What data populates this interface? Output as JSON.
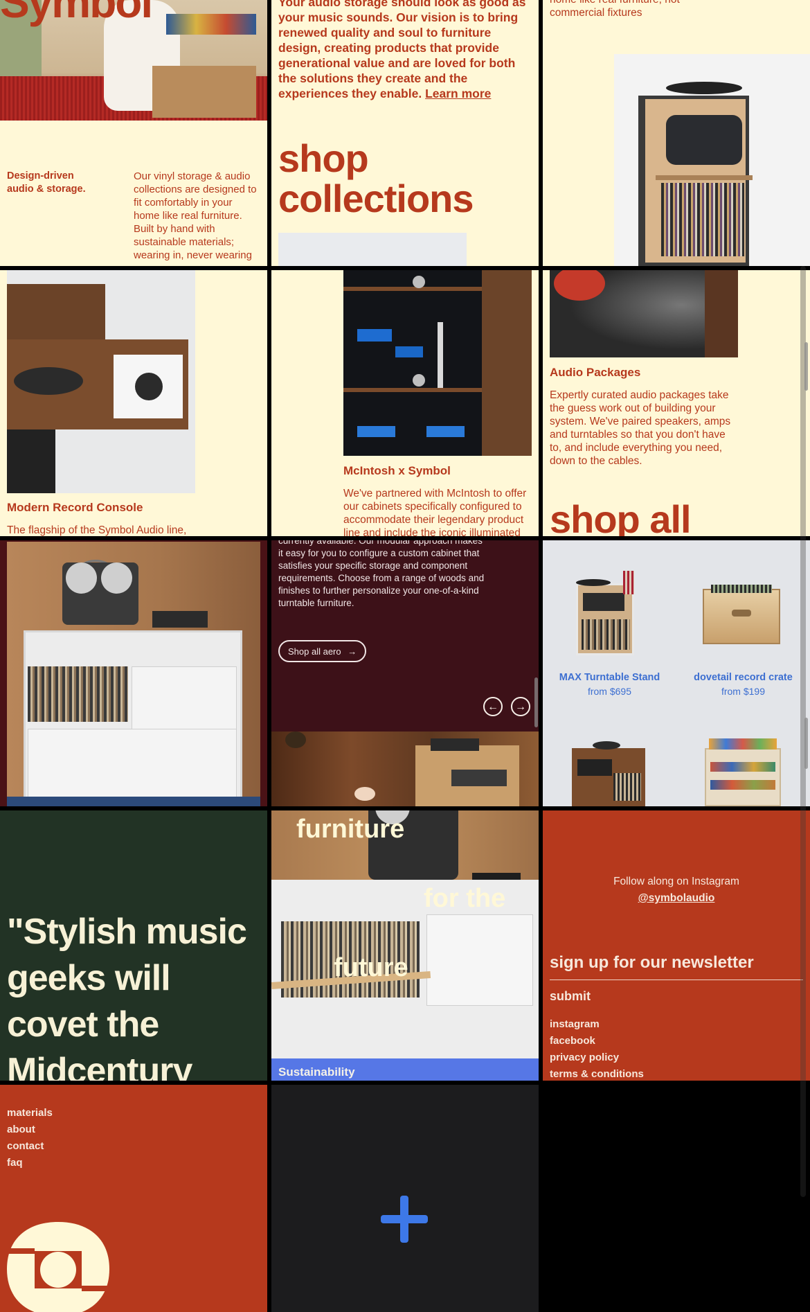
{
  "hero": {
    "brand_word": "Symbol",
    "tagline": "Design-driven audio & storage.",
    "description": "Our vinyl storage & audio collections are designed to fit comfortably in your home like real furniture. Built by hand with sustainable materials; wearing in, never wearing"
  },
  "vision": {
    "text": "Your audio storage should look as good as your music sounds. Our vision is to bring renewed quality and soul to furniture design, creating products that provide generational value and are loved for both the solutions they create and the experiences they enable.",
    "learn_more": "Learn more",
    "shop_collections_line1": "shop",
    "shop_collections_line2": "collections"
  },
  "fixtures": {
    "text_line1": "home like real furniture, not",
    "text_line2": "commercial fixtures"
  },
  "collections": {
    "modern": {
      "title": "Modern Record Console",
      "desc": "The flagship of the Symbol Audio line,"
    },
    "mcintosh": {
      "title": "McIntosh x Symbol",
      "desc": "We've partnered with McIntosh to offer our cabinets specifically configured to accommodate their legendary product line and include the iconic illuminated"
    },
    "audio_packages": {
      "title": "Audio Packages",
      "desc": "Expertly curated audio packages take the guess work out of building your system. We've paired speakers, amps and turntables so that you don't have to, and include everything you need, down to the cables."
    },
    "shop_all": "shop all"
  },
  "aero": {
    "text": "currently available. Our modular approach makes it easy for you to configure a custom cabinet that satisfies your specific storage and component requirements. Choose from a range of woods and finishes to further personalize your one-of-a-kind turntable furniture.",
    "button": "Shop all aero",
    "button_arrow": "→",
    "prev": "←",
    "next": "→"
  },
  "products": [
    {
      "name": "MAX Turntable Stand",
      "price": "from $695"
    },
    {
      "name": "dovetail record crate",
      "price": "from $199"
    }
  ],
  "quote": {
    "text": "\"Stylish music geeks will covet the Midcentury"
  },
  "furniture_tile": {
    "word1": "furniture",
    "word2": "for the",
    "word3": "future",
    "footer": "Sustainability"
  },
  "social": {
    "follow": "Follow along on Instagram",
    "handle": "@symbolaudio",
    "newsletter": "sign up for our newsletter",
    "submit": "submit",
    "links": [
      "instagram",
      "facebook",
      "privacy policy",
      "terms & conditions"
    ]
  },
  "footer_links": [
    "materials",
    "about",
    "contact",
    "faq"
  ],
  "plus_symbol": "+",
  "colors": {
    "cream": "#fff8d7",
    "rust": "#b6391d",
    "deep_green": "#223325",
    "maroon": "#3d1118",
    "blue": "#5677e6",
    "product_blue": "#3d6fd1",
    "dark_gray": "#1c1c1e"
  },
  "icons": [
    "plus-icon",
    "arrow-left-icon",
    "arrow-right-icon",
    "logo-icon"
  ]
}
